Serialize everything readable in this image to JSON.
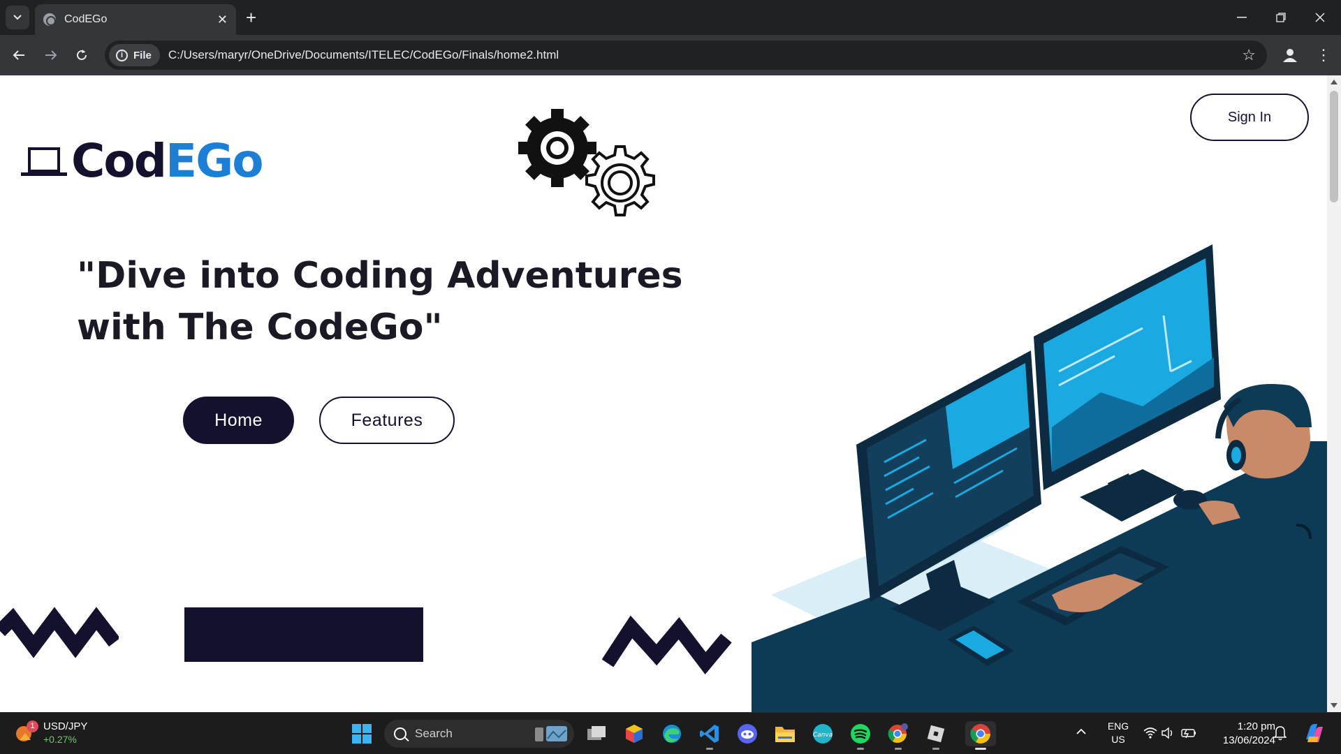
{
  "browser": {
    "tab_title": "CodEGo",
    "site_chip": "File",
    "url": "C:/Users/maryr/OneDrive/Documents/ITELEC/CodEGo/Finals/home2.html"
  },
  "page": {
    "logo_text_a": "Cod",
    "logo_text_b": "EGo",
    "signin_label": "Sign In",
    "headline_line1": "\"Dive into Coding Adventures",
    "headline_line2": "with The CodeGo\"",
    "home_label": "Home",
    "features_label": "Features"
  },
  "colors": {
    "brand_dark": "#14112e",
    "brand_blue": "#1b7fd6",
    "hero_navy": "#0d3b55",
    "hero_cyan": "#1aa9e0"
  },
  "taskbar": {
    "ticker_badge": "1",
    "ticker_name": "USD/JPY",
    "ticker_change": "+0.27%",
    "search_label": "Search",
    "lang_line1": "ENG",
    "lang_line2": "US",
    "time": "1:20 pm",
    "date": "13/06/2024",
    "apps": [
      "windows-start",
      "task-view",
      "app-cube",
      "edge",
      "vscode",
      "discord",
      "file-explorer",
      "canva",
      "spotify",
      "chrome-alt",
      "roblox",
      "chrome"
    ]
  }
}
